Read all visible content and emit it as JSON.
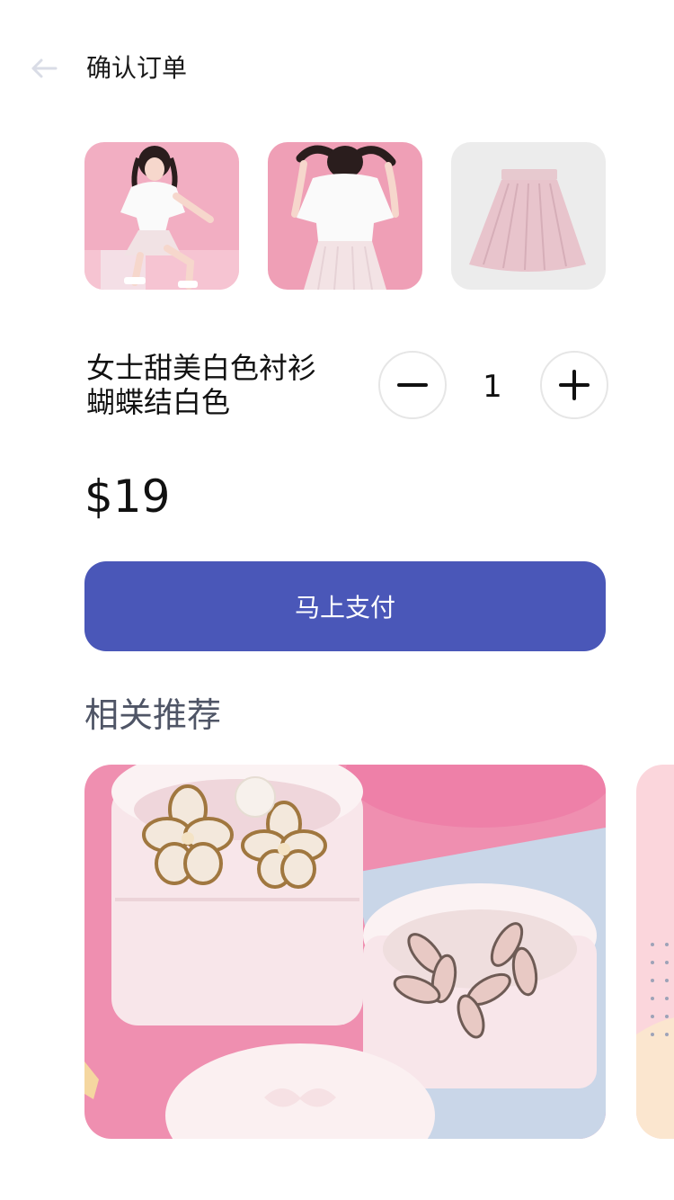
{
  "header": {
    "back_icon": "arrow-left-icon",
    "title": "确认订单"
  },
  "gallery": {
    "images": [
      {
        "name": "model-front-photo",
        "bg": "#f0a9bf"
      },
      {
        "name": "model-back-photo",
        "bg": "#ef9fb6"
      },
      {
        "name": "skirt-photo",
        "bg": "#ececec"
      }
    ]
  },
  "product": {
    "name_line1": "女士甜美白色衬衫",
    "name_line2": "蝴蝶结白色",
    "quantity": "1",
    "price": "$19",
    "minus_icon": "minus-icon",
    "plus_icon": "plus-icon"
  },
  "actions": {
    "pay_label": "马上支付"
  },
  "recommend": {
    "title": "相关推荐"
  },
  "colors": {
    "accent": "#4a57b8",
    "section_title": "#4f5566",
    "back_icon": "#d9dce6"
  }
}
